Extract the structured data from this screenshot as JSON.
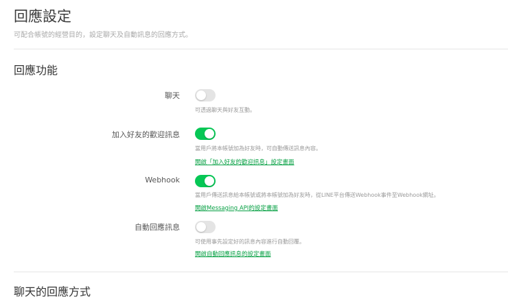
{
  "header": {
    "title": "回應設定",
    "subtitle": "可配合帳號的經營目的，設定聊天及自動訊息的回應方式。"
  },
  "section": {
    "title": "回應功能"
  },
  "settings": [
    {
      "label": "聊天",
      "enabled": false,
      "description": "可透過聊天與好友互動。",
      "link": null
    },
    {
      "label": "加入好友的歡迎訊息",
      "enabled": true,
      "description": "當用戶將本帳號加為好友時，可自動傳送訊息內容。",
      "link": "開啟「加入好友的歡迎訊息」設定畫面"
    },
    {
      "label": "Webhook",
      "enabled": true,
      "description": "當用戶傳送訊息給本帳號或將本帳號加為好友時，從LINE平台傳送Webhook事件至Webhook網址。",
      "link": "開啟Messaging API的設定畫面"
    },
    {
      "label": "自動回應訊息",
      "enabled": false,
      "description": "可使用事先設定好的訊息內容進行自動回覆。",
      "link": "開啟自動回應訊息的設定畫面"
    }
  ],
  "section2": {
    "title": "聊天的回應方式"
  },
  "colors": {
    "accent": "#06c755",
    "link": "#06a043"
  }
}
